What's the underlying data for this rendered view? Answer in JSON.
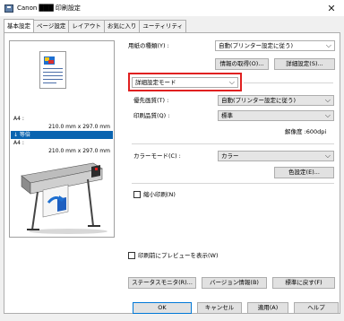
{
  "window": {
    "title": "Canon ███ 印刷設定",
    "close_glyph": "✕"
  },
  "tabs": [
    {
      "label": "基本設定"
    },
    {
      "label": "ページ設定"
    },
    {
      "label": "レイアウト"
    },
    {
      "label": "お気に入り"
    },
    {
      "label": "ユーティリティ"
    }
  ],
  "paper_info": {
    "top_label": "A4 :",
    "top_size": "210.0 mm x 297.0 mm",
    "scale_label": "↓ 等倍",
    "bottom_label": "A4 :",
    "bottom_size": "210.0 mm x 297.0 mm"
  },
  "media": {
    "label": "用紙の種類(Y) :",
    "value": "自動(プリンター設定に従う)",
    "get_info_button": "情報の取得(O)...",
    "settings_button": "詳細設定(S)..."
  },
  "mode": {
    "value": "詳細設定モード"
  },
  "priority": {
    "label": "優先画質(T) :",
    "value": "自動(プリンター設定に従う)"
  },
  "quality": {
    "label": "印刷品質(Q) :",
    "value": "標準",
    "resolution": "解像度 :600dpi"
  },
  "color_mode": {
    "label": "カラーモード(C) :",
    "value": "カラー",
    "settings_button": "色設定(E)..."
  },
  "shrink": {
    "label": "縮小印刷(N)",
    "checked": false
  },
  "preview": {
    "label": "印刷前にプレビューを表示(W)",
    "checked": false
  },
  "bottom_buttons": {
    "status_monitor": "ステータスモニタ(R)...",
    "version_info": "バージョン情報(B)",
    "restore_defaults": "標準に戻す(F)"
  },
  "dialog_buttons": {
    "ok": "OK",
    "cancel": "キャンセル",
    "apply": "適用(A)",
    "help": "ヘルプ"
  },
  "colors": {
    "highlight": "#e02020",
    "selection": "#0a64b0",
    "accent_border": "#0078d7"
  }
}
